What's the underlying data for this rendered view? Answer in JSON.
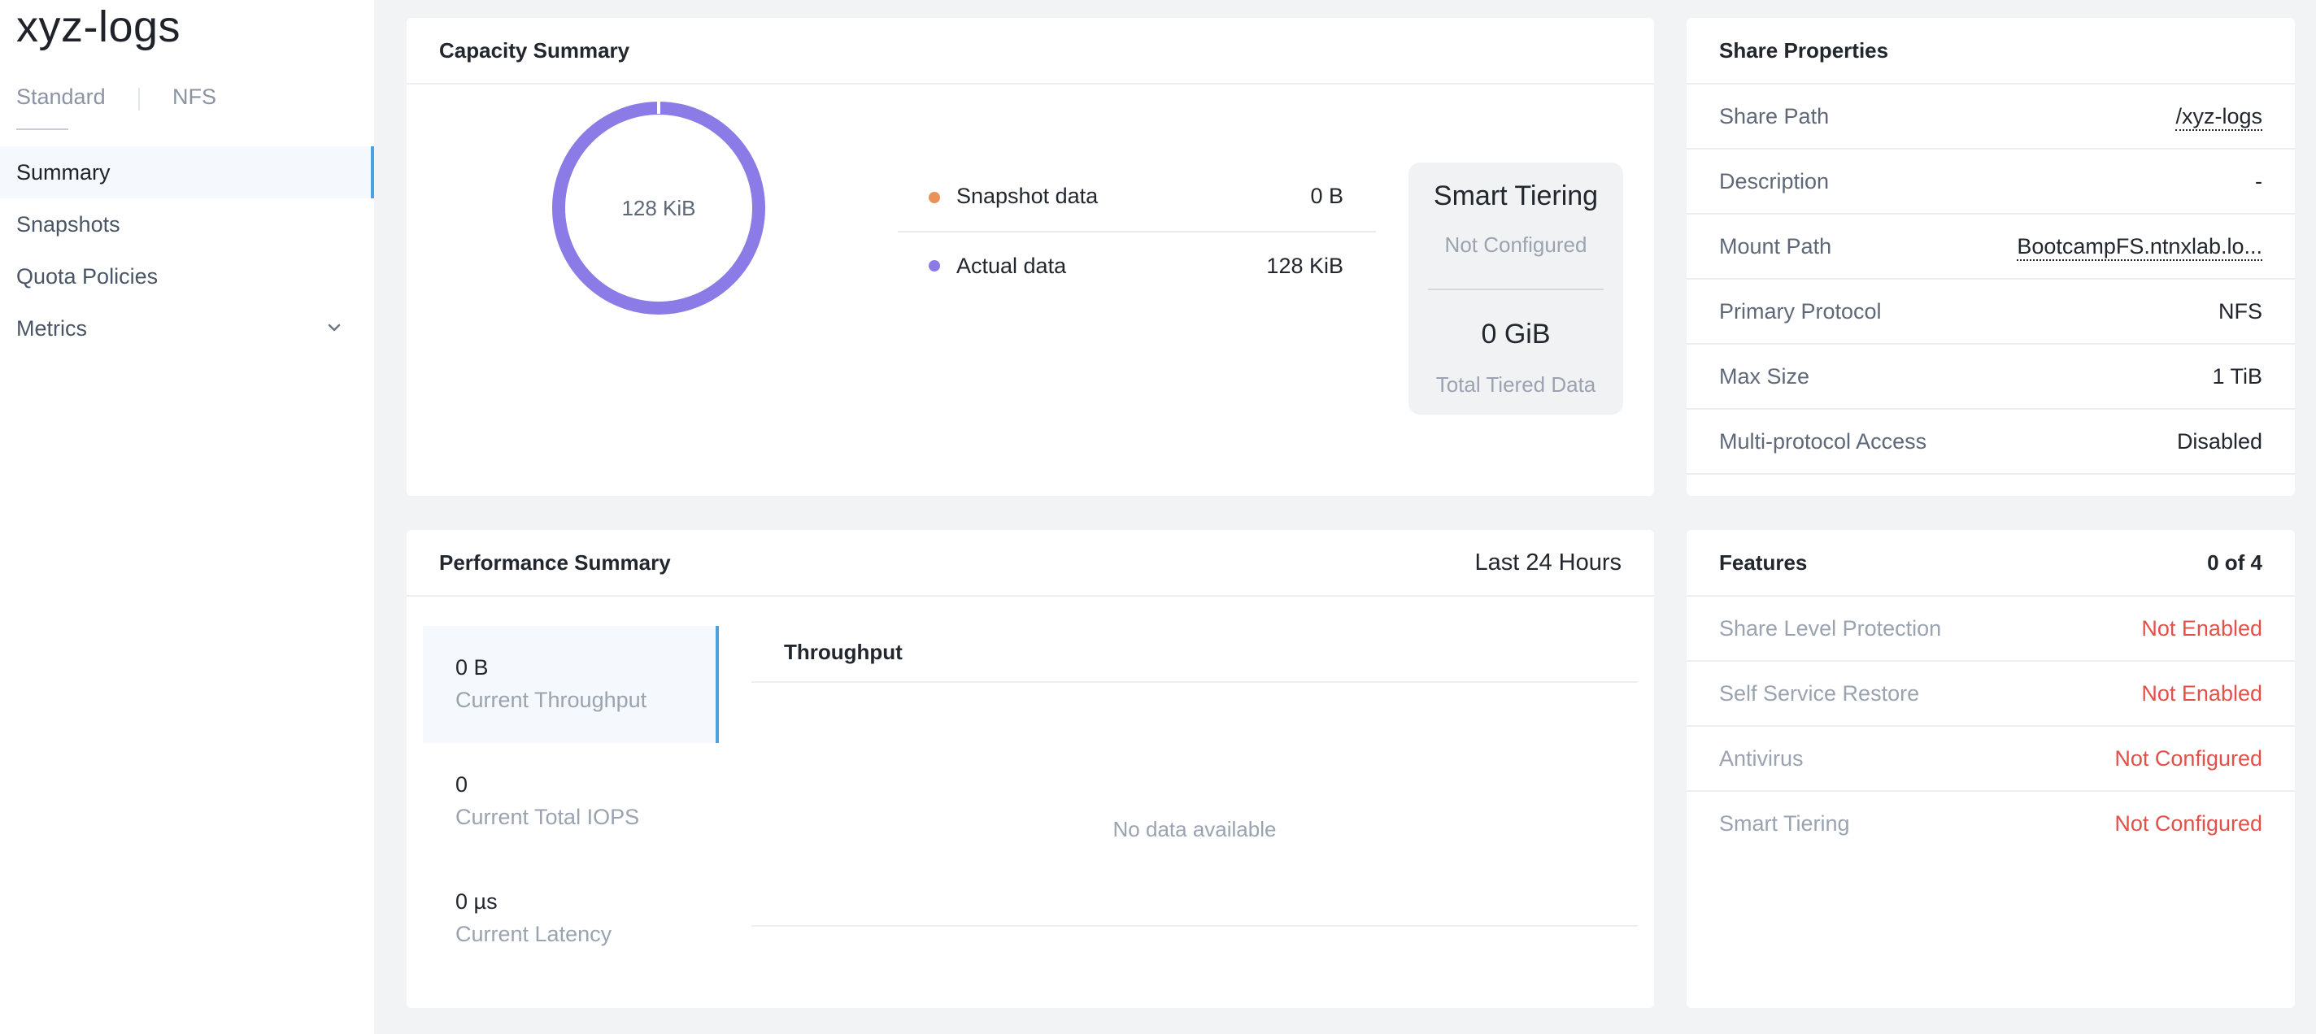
{
  "share": {
    "name": "xyz-logs",
    "sub_tabs": [
      "Standard",
      "NFS"
    ]
  },
  "nav": {
    "items": [
      {
        "label": "Summary",
        "active": true
      },
      {
        "label": "Snapshots"
      },
      {
        "label": "Quota Policies"
      },
      {
        "label": "Metrics",
        "has_chevron": true
      }
    ]
  },
  "capacity": {
    "title": "Capacity Summary",
    "donut_label": "128 KiB",
    "legend": [
      {
        "name": "Snapshot data",
        "value": "0 B",
        "color": "#e8915a"
      },
      {
        "name": "Actual data",
        "value": "128 KiB",
        "color": "#8b7be6"
      }
    ],
    "tiering": {
      "title": "Smart Tiering",
      "status": "Not Configured",
      "value": "0 GiB",
      "caption": "Total Tiered Data"
    }
  },
  "properties": {
    "title": "Share Properties",
    "rows": [
      {
        "key": "Share Path",
        "value": "/xyz-logs"
      },
      {
        "key": "Description",
        "value": "-"
      },
      {
        "key": "Mount Path",
        "value": "BootcampFS.ntnxlab.lo..."
      },
      {
        "key": "Primary Protocol",
        "value": "NFS"
      },
      {
        "key": "Max Size",
        "value": "1 TiB"
      },
      {
        "key": "Multi-protocol Access",
        "value": "Disabled"
      }
    ]
  },
  "performance": {
    "title": "Performance Summary",
    "range": "Last 24 Hours",
    "metrics": [
      {
        "value": "0 B",
        "caption": "Current Throughput"
      },
      {
        "value": "0",
        "caption": "Current Total IOPS"
      },
      {
        "value": "0 µs",
        "caption": "Current Latency"
      }
    ],
    "chart_title": "Throughput",
    "empty_text": "No data available"
  },
  "features": {
    "title": "Features",
    "count": "0 of 4",
    "rows": [
      {
        "key": "Share Level Protection",
        "value": "Not Enabled"
      },
      {
        "key": "Self Service Restore",
        "value": "Not Enabled"
      },
      {
        "key": "Antivirus",
        "value": "Not Configured"
      },
      {
        "key": "Smart Tiering",
        "value": "Not Configured"
      }
    ],
    "status_color": "#e0514a"
  },
  "colors": {
    "accent": "#4aa3e0",
    "donut": "#8b7be6"
  }
}
